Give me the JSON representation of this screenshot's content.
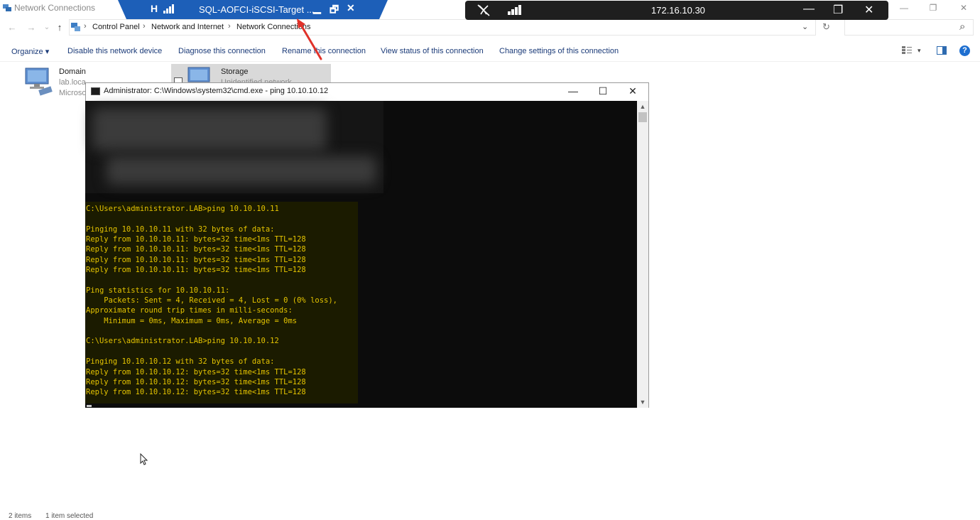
{
  "explorer": {
    "title": "Network Connections",
    "window_controls": {
      "minimize": "—",
      "maximize": "❐",
      "close": "✕"
    },
    "nav": {
      "back": "←",
      "forward": "→",
      "recent": "⌄",
      "up": "↑"
    },
    "breadcrumbs": [
      "Control Panel",
      "Network and Internet",
      "Network Connections"
    ],
    "breadcrumb_sep": "›",
    "address_dropdown": "⌄",
    "refresh": "↻",
    "search_placeholder": "",
    "search_icon": "⌕",
    "commands": [
      "Organize ▾",
      "Disable this network device",
      "Diagnose this connection",
      "Rename this connection",
      "View status of this connection",
      "Change settings of this connection"
    ],
    "view_dropdown": "▾",
    "help": "?",
    "items": [
      {
        "name": "Domain",
        "line2": "lab.loca",
        "line3": "Microso"
      },
      {
        "name": "Storage",
        "line2": "Unidentified network",
        "checkbox": ""
      }
    ],
    "status": {
      "count": "2 items",
      "selected": "1 item selected"
    }
  },
  "remote_session": {
    "title": "SQL-AOFCI-iSCSI-Target ...",
    "minimize": "▁",
    "restore": "🗗",
    "close": "✕",
    "pin": "H"
  },
  "remote_connection": {
    "ip": "172.16.10.30",
    "minimize": "—",
    "restore": "❐",
    "close": "✕"
  },
  "cmd": {
    "title": "Administrator: C:\\Windows\\system32\\cmd.exe - ping  10.10.10.12",
    "minimize": "—",
    "maximize": "☐",
    "close": "✕",
    "console_lines": [
      "C:\\Users\\administrator.LAB>ping 10.10.10.11",
      "",
      "Pinging 10.10.10.11 with 32 bytes of data:",
      "Reply from 10.10.10.11: bytes=32 time<1ms TTL=128",
      "Reply from 10.10.10.11: bytes=32 time<1ms TTL=128",
      "Reply from 10.10.10.11: bytes=32 time<1ms TTL=128",
      "Reply from 10.10.10.11: bytes=32 time<1ms TTL=128",
      "",
      "Ping statistics for 10.10.10.11:",
      "    Packets: Sent = 4, Received = 4, Lost = 0 (0% loss),",
      "Approximate round trip times in milli-seconds:",
      "    Minimum = 0ms, Maximum = 0ms, Average = 0ms",
      "",
      "C:\\Users\\administrator.LAB>ping 10.10.10.12",
      "",
      "Pinging 10.10.10.12 with 32 bytes of data:",
      "Reply from 10.10.10.12: bytes=32 time<1ms TTL=128",
      "Reply from 10.10.10.12: bytes=32 time<1ms TTL=128",
      "Reply from 10.10.10.12: bytes=32 time<1ms TTL=128"
    ],
    "scroll_up": "▲",
    "scroll_down": "▼"
  },
  "colors": {
    "console_text": "#e5c400",
    "remote_bar_blue": "#1d5fb8",
    "arrow_red": "#e0322a"
  }
}
